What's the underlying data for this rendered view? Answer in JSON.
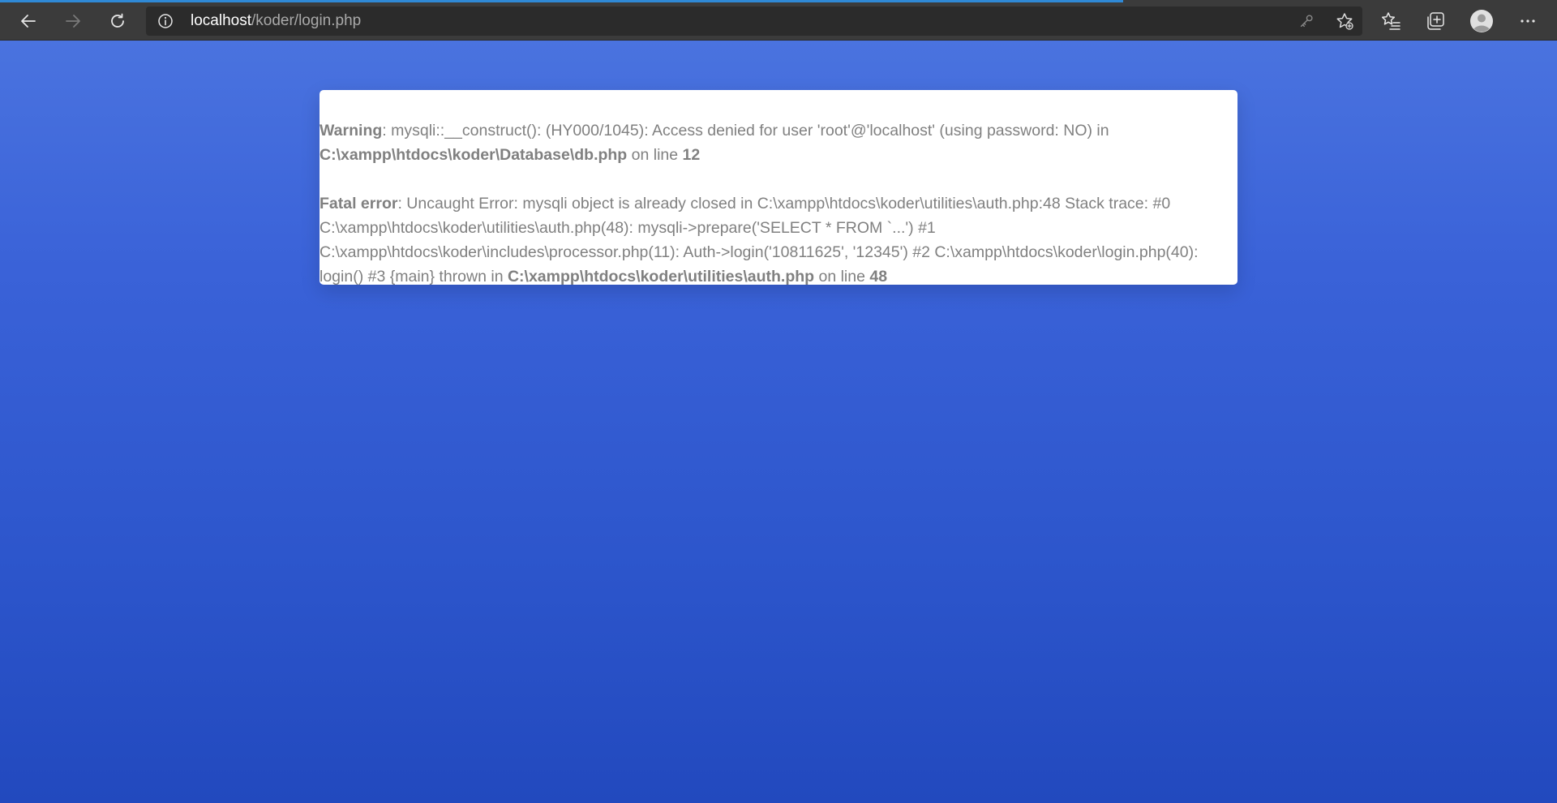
{
  "browser": {
    "url_host": "localhost",
    "url_path": "/koder/login.php",
    "icons": {
      "back": "back-arrow-icon",
      "forward": "forward-arrow-icon",
      "refresh": "refresh-icon",
      "info": "info-icon",
      "key": "key-icon",
      "add_favorite": "star-add-icon",
      "favorites": "favorites-list-icon",
      "collections": "collections-icon",
      "profile": "profile-avatar-icon",
      "menu": "more-menu-icon"
    }
  },
  "error": {
    "warning": {
      "label": "Warning",
      "message": ": mysqli::__construct(): (HY000/1045): Access denied for user 'root'@'localhost' (using password: NO) in ",
      "file": "C:\\xampp\\htdocs\\koder\\Database\\db.php",
      "on_line_text": " on line ",
      "line": "12"
    },
    "fatal": {
      "label": "Fatal error",
      "message": ": Uncaught Error: mysqli object is already closed in C:\\xampp\\htdocs\\koder\\utilities\\auth.php:48 Stack trace: #0 C:\\xampp\\htdocs\\koder\\utilities\\auth.php(48): mysqli->prepare('SELECT * FROM `...') #1 C:\\xampp\\htdocs\\koder\\includes\\processor.php(11): Auth->login('10811625', '12345') #2 C:\\xampp\\htdocs\\koder\\login.php(40): login() #3 {main} thrown in ",
      "file": "C:\\xampp\\htdocs\\koder\\utilities\\auth.php",
      "on_line_text": " on line ",
      "line": "48"
    }
  },
  "colors": {
    "toolbar_bg": "#3b3b3b",
    "address_bg": "#2b2b2b",
    "page_gradient_top": "#4a73df",
    "page_gradient_bottom": "#2249be",
    "error_text": "#808080",
    "load_bar": "#2f89d6"
  }
}
